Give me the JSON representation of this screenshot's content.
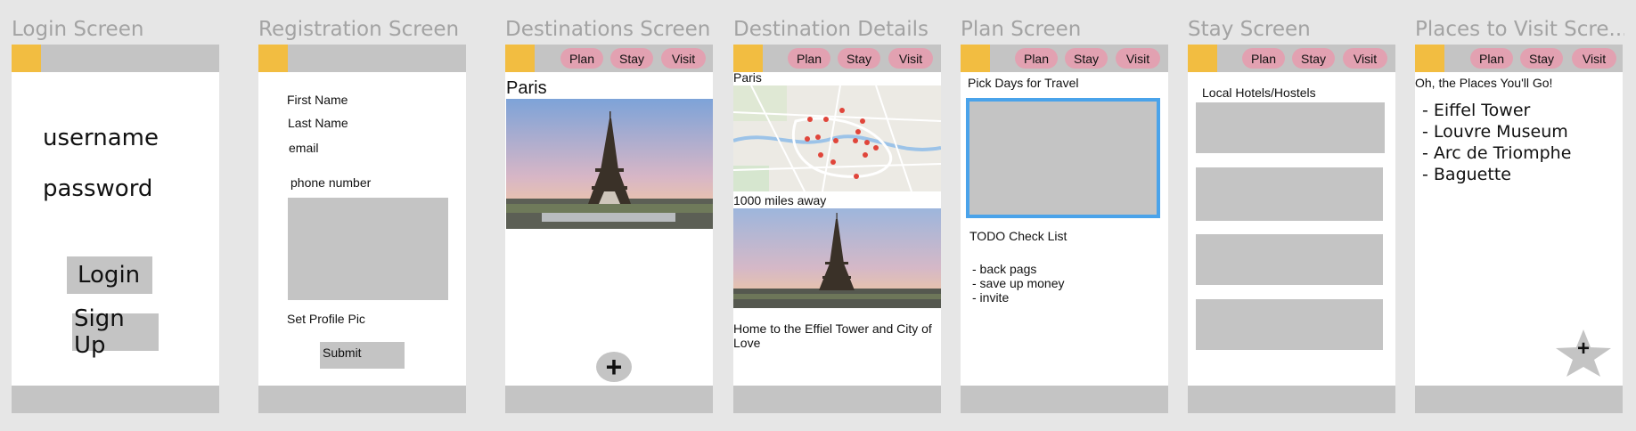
{
  "screens": {
    "login": {
      "title": "Login Screen",
      "username_label": "username",
      "password_label": "password",
      "login_button": "Login",
      "signup_button": "Sign Up"
    },
    "registration": {
      "title": "Registration Screen",
      "first_name_label": "First Name",
      "last_name_label": "Last Name",
      "email_label": "email",
      "phone_label": "phone number",
      "profile_pic_label": "Set Profile Pic",
      "submit_button": "Submit"
    },
    "destinations": {
      "title": "Destinations Screen",
      "city": "Paris",
      "add_glyph": "+"
    },
    "destination_details": {
      "title": "Destination Details ...",
      "city": "Paris",
      "distance": "1000 miles away",
      "description": "Home to the Effiel Tower and City of Love"
    },
    "plan": {
      "title": "Plan Screen",
      "pick_days_label": "Pick Days for Travel",
      "todo_title": "TODO Check List",
      "todo_items": [
        "- back pags",
        "- save up money",
        "- invite"
      ]
    },
    "stay": {
      "title": "Stay Screen",
      "hotels_label": "Local Hotels/Hostels"
    },
    "places": {
      "title": "Places to Visit Scre...",
      "subtitle": "Oh, the Places You'll Go!",
      "places": [
        "- Eiffel Tower",
        "- Louvre Museum",
        "- Arc de Triomphe",
        "- Baguette"
      ],
      "add_glyph": "+"
    }
  },
  "nav": {
    "plan": "Plan",
    "stay": "Stay",
    "visit": "Visit"
  },
  "colors": {
    "canvas": "#e6e6e6",
    "bar": "#c4c4c4",
    "logo": "#f2bd41",
    "nav_pill": "#e2a1b1",
    "calendar_border": "#4aa3ea"
  }
}
